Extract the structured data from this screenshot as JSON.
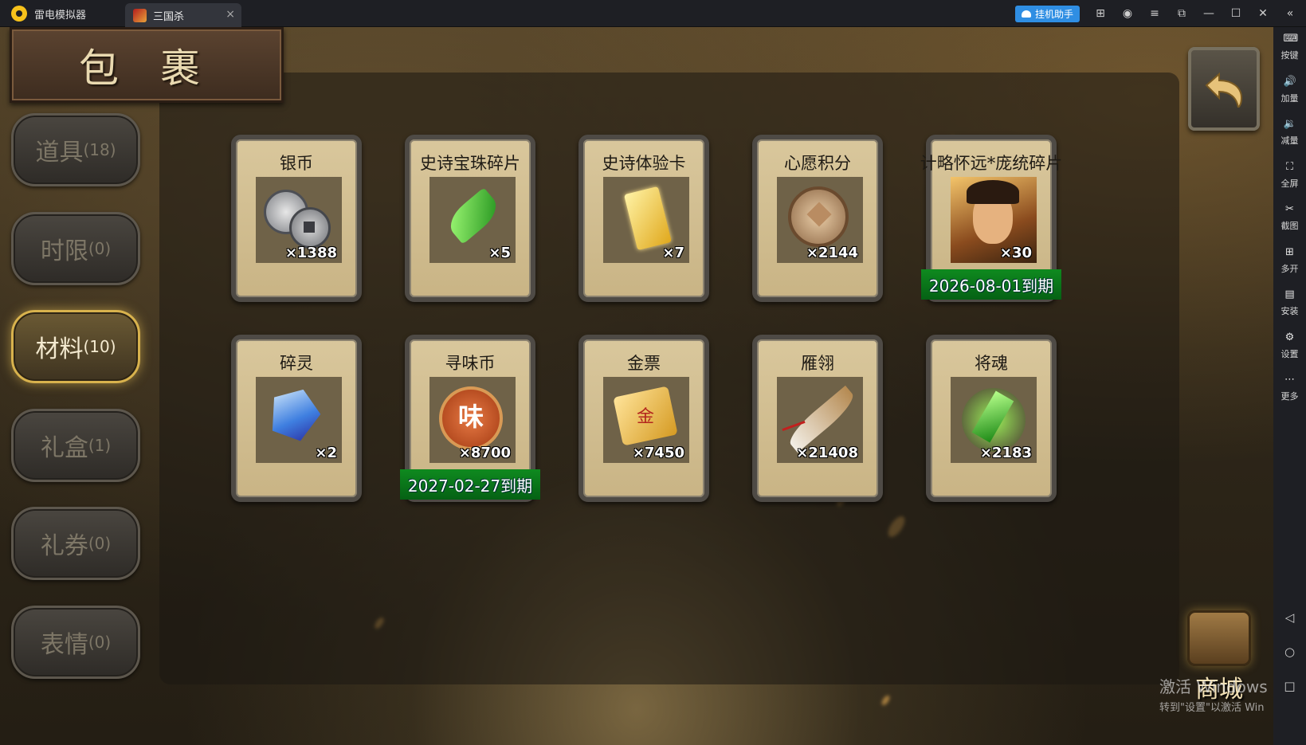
{
  "window": {
    "app_name": "雷电模拟器",
    "tab_title": "三国杀",
    "tab_close": "×",
    "assist_label": "挂机助手",
    "icons": [
      "gift-icon",
      "account-icon",
      "menu-icon",
      "restore-icon",
      "minimize-icon",
      "maximize-icon",
      "close-icon",
      "collapse-icon"
    ],
    "icon_glyphs": [
      "⊞",
      "◉",
      "≡",
      "⧉",
      "—",
      "☐",
      "✕",
      "«"
    ]
  },
  "side_panel": {
    "items": [
      {
        "label": "按键",
        "glyph": "⌨"
      },
      {
        "label": "加量",
        "glyph": "🔊"
      },
      {
        "label": "减量",
        "glyph": "🔉"
      },
      {
        "label": "全屏",
        "glyph": "⛶"
      },
      {
        "label": "截图",
        "glyph": "✂"
      },
      {
        "label": "多开",
        "glyph": "⊞"
      },
      {
        "label": "安装",
        "glyph": "▤"
      },
      {
        "label": "设置",
        "glyph": "⚙"
      },
      {
        "label": "更多",
        "glyph": "⋯"
      }
    ],
    "nav": [
      "◁",
      "○",
      "□"
    ]
  },
  "game": {
    "title": "包 裹",
    "categories": [
      {
        "label": "道具",
        "count": "(18)",
        "active": false
      },
      {
        "label": "时限",
        "count": "(0)",
        "active": false
      },
      {
        "label": "材料",
        "count": "(10)",
        "active": true
      },
      {
        "label": "礼盒",
        "count": "(1)",
        "active": false
      },
      {
        "label": "礼券",
        "count": "(0)",
        "active": false
      },
      {
        "label": "表情",
        "count": "(0)",
        "active": false
      }
    ],
    "items": [
      {
        "name": "银币",
        "qty": "×1388",
        "icon": "silver-coin-icon",
        "expiry": ""
      },
      {
        "name": "史诗宝珠碎片",
        "qty": "×5",
        "icon": "green-gem-shard-icon",
        "expiry": ""
      },
      {
        "name": "史诗体验卡",
        "qty": "×7",
        "icon": "gold-card-icon",
        "expiry": ""
      },
      {
        "name": "心愿积分",
        "qty": "×2144",
        "icon": "heart-coin-icon",
        "expiry": ""
      },
      {
        "name": "计略怀远*庞统碎片",
        "qty": "×30",
        "icon": "hero-portrait-icon",
        "expiry": "2026-08-01到期"
      },
      {
        "name": "碎灵",
        "qty": "×2",
        "icon": "blue-crystal-icon",
        "expiry": ""
      },
      {
        "name": "寻味币",
        "qty": "×8700",
        "icon": "flavor-coin-icon",
        "expiry": "2027-02-27到期"
      },
      {
        "name": "金票",
        "qty": "×7450",
        "icon": "gold-ticket-icon",
        "expiry": ""
      },
      {
        "name": "雁翎",
        "qty": "×21408",
        "icon": "feather-icon",
        "expiry": ""
      },
      {
        "name": "将魂",
        "qty": "×2183",
        "icon": "green-soul-crystal-icon",
        "expiry": ""
      }
    ],
    "shop_label": "商城",
    "back_icon": "back-arrow-icon"
  },
  "watermark": {
    "line1": "激活 Windows",
    "line2": "转到\"设置\"以激活 Win"
  }
}
